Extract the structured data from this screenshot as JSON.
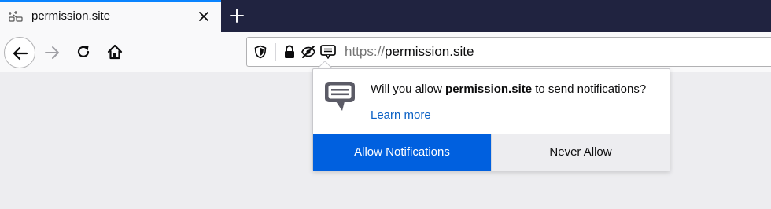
{
  "tab": {
    "title": "permission.site",
    "favicon": "site-permissions-icon"
  },
  "toolbar": {
    "icons": [
      "back-arrow-icon",
      "forward-arrow-icon",
      "reload-icon",
      "home-icon"
    ]
  },
  "urlbar": {
    "scheme": "https://",
    "host": "permission.site",
    "icons": [
      "shield-icon",
      "lock-icon",
      "tracking-blocked-icon",
      "notification-permission-icon"
    ]
  },
  "popup": {
    "message_prefix": "Will you allow ",
    "site": "permission.site",
    "message_suffix": " to send notifications?",
    "learn_more": "Learn more",
    "allow_label": "Allow Notifications",
    "never_label": "Never Allow",
    "icon": "notification-bubble-icon"
  },
  "colors": {
    "accent": "#0060df",
    "tab_accent": "#0a84ff",
    "titlebar": "#202340",
    "link": "#0a60c4"
  }
}
